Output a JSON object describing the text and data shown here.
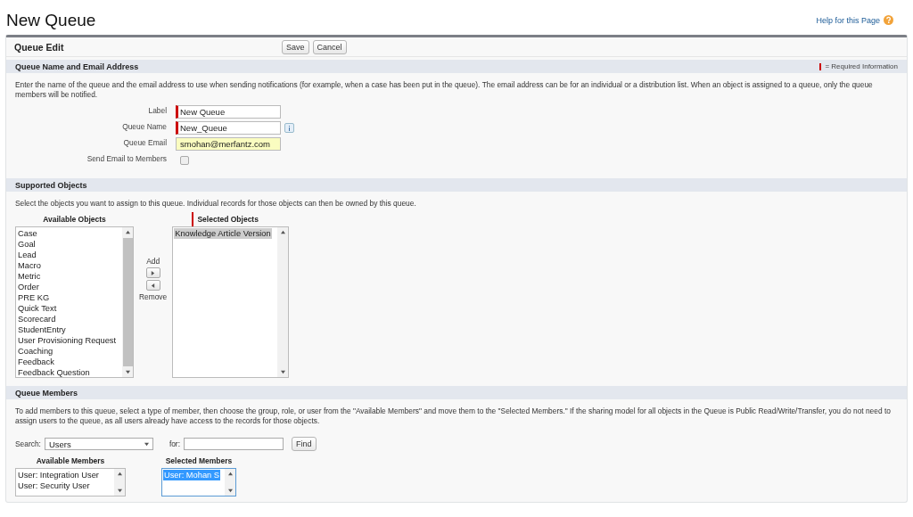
{
  "page_title": "New Queue",
  "help_link": "Help for this Page",
  "panel": {
    "title": "Queue Edit",
    "buttons": [
      "Save",
      "Cancel"
    ]
  },
  "name_section": {
    "title": "Queue Name and Email Address",
    "required_legend": "= Required Information",
    "description": "Enter the name of the queue and the email address to use when sending notifications (for example, when a case has been put in the queue). The email address can be for an individual or a distribution list. When an object is assigned to a queue, only the queue members will be notified.",
    "fields": [
      {
        "kind": "text",
        "label": "Label",
        "value": "New Queue",
        "required": true,
        "info": false,
        "highlighted": false
      },
      {
        "kind": "text",
        "label": "Queue Name",
        "value": "New_Queue",
        "required": true,
        "info": true,
        "highlighted": false
      },
      {
        "kind": "text",
        "label": "Queue Email",
        "value": "smohan@merfantz.com",
        "required": false,
        "info": false,
        "highlighted": true
      },
      {
        "kind": "checkbox",
        "label": "Send Email to Members",
        "checked": false
      }
    ]
  },
  "objects_section": {
    "title": "Supported Objects",
    "description": "Select the objects you want to assign to this queue. Individual records for those objects can then be owned by this queue.",
    "available": {
      "heading": "Available Objects",
      "required": false,
      "focused": false,
      "items": [
        {
          "label": "Case",
          "selected": false
        },
        {
          "label": "Goal",
          "selected": false
        },
        {
          "label": "Lead",
          "selected": false
        },
        {
          "label": "Macro",
          "selected": false
        },
        {
          "label": "Metric",
          "selected": false
        },
        {
          "label": "Order",
          "selected": false
        },
        {
          "label": "PRE KG",
          "selected": false
        },
        {
          "label": "Quick Text",
          "selected": false
        },
        {
          "label": "Scorecard",
          "selected": false
        },
        {
          "label": "StudentEntry",
          "selected": false
        },
        {
          "label": "User Provisioning Request",
          "selected": false
        },
        {
          "label": "Coaching",
          "selected": false
        },
        {
          "label": "Feedback",
          "selected": false
        },
        {
          "label": "Feedback Question",
          "selected": false
        }
      ]
    },
    "add_label": "Add",
    "remove_label": "Remove",
    "selected": {
      "heading": "Selected Objects",
      "required": true,
      "focused": false,
      "items": [
        {
          "label": "Knowledge Article Version",
          "selected": true
        }
      ]
    }
  },
  "members_section": {
    "title": "Queue Members",
    "description": "To add members to this queue, select a type of member, then choose the group, role, or user from the \"Available Members\" and move them to the \"Selected Members.\" If the sharing model for all objects in the Queue is Public Read/Write/Transfer, you do not need to assign users to the queue, as all users already have access to the records for those objects.",
    "search_label": "Search:",
    "search_value": "Users",
    "for_label": "for:",
    "find_button": "Find",
    "available": {
      "heading": "Available Members",
      "required": false,
      "focused": false,
      "items": [
        {
          "label": "User: Integration User",
          "selected": false
        },
        {
          "label": "User: Security User",
          "selected": false
        }
      ]
    },
    "selected": {
      "heading": "Selected Members",
      "required": false,
      "focused": true,
      "items": [
        {
          "label": "User: Mohan S",
          "selected": true
        }
      ]
    }
  }
}
